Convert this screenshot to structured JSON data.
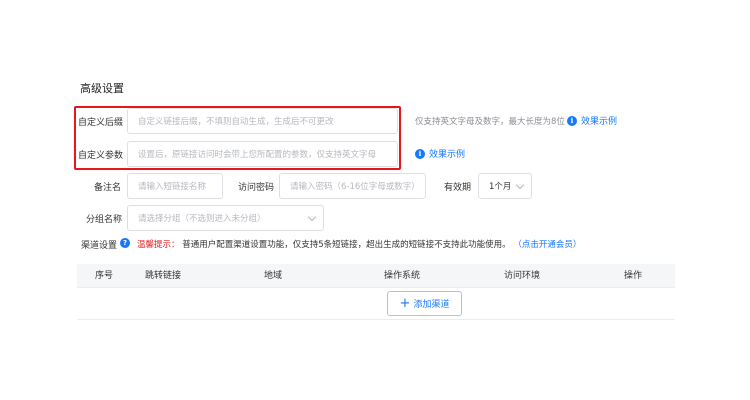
{
  "section_title": "高级设置",
  "custom_suffix": {
    "label": "自定义后缀",
    "placeholder": "自定义链接后缀，不填则自动生成，生成后不可更改",
    "hint": "仅支持英文字母及数字，最大长度为8位",
    "example_link": "效果示例"
  },
  "custom_params": {
    "label": "自定义参数",
    "placeholder": "设置后，原链接访问时会带上您所配置的参数，仅支持英文字母",
    "example_link": "效果示例"
  },
  "remark": {
    "label": "备注名",
    "placeholder": "请输入短链接名称"
  },
  "password": {
    "label": "访问密码",
    "placeholder": "请输入密码（6-16位字母或数字）"
  },
  "validity": {
    "label": "有效期",
    "value": "1个月"
  },
  "group": {
    "label": "分组名称",
    "placeholder": "请选择分组（不选则进入未分组）"
  },
  "channel": {
    "label": "渠道设置",
    "notice_prefix": "温馨提示：",
    "notice_text": "普通用户配置渠道设置功能，仅支持5条短链接，超出生成的短链接不支持此功能使用。",
    "notice_link": "（点击开通会员）"
  },
  "table": {
    "columns": [
      "序号",
      "跳转链接",
      "地域",
      "操作系统",
      "访问环境",
      "操作"
    ]
  },
  "add_channel_label": "添加渠道",
  "colors": {
    "accent": "#1677ff",
    "highlight_box": "#e8161b",
    "warning_text": "#e8161b"
  }
}
